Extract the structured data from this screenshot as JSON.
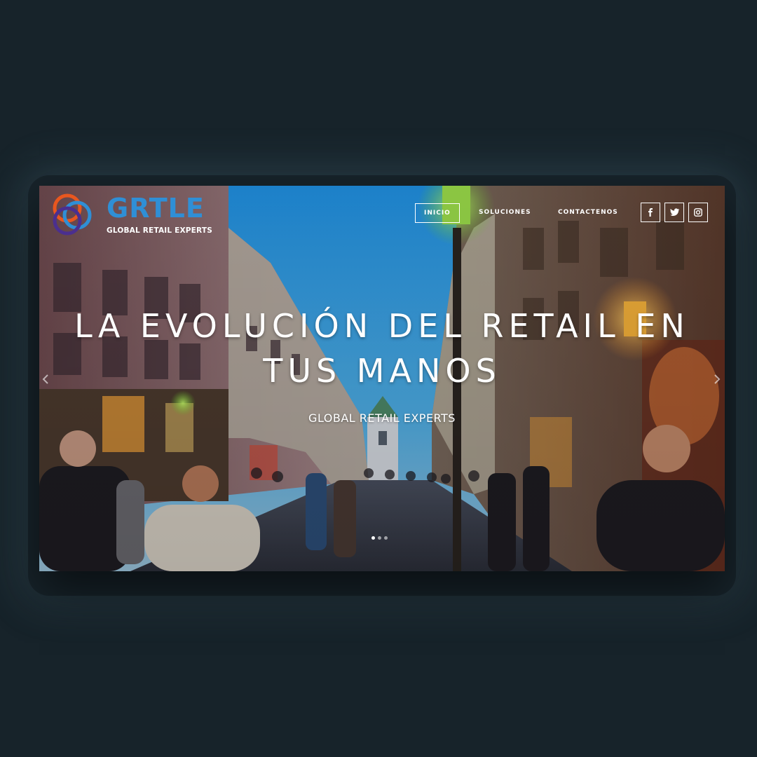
{
  "brand": {
    "name": "GRTLE",
    "tagline": "GLOBAL RETAIL EXPERTS",
    "colors": {
      "word": "#2f8fd6",
      "ring_orange": "#e8571f",
      "ring_blue": "#2f8fd6",
      "ring_purple": "#4b2f8f"
    }
  },
  "nav": {
    "items": [
      {
        "label": "INICIO",
        "active": true
      },
      {
        "label": "SOLUCIONES",
        "active": false
      },
      {
        "label": "CONTACTENOS",
        "active": false
      }
    ]
  },
  "social": {
    "items": [
      {
        "icon": "facebook-icon"
      },
      {
        "icon": "twitter-icon"
      },
      {
        "icon": "instagram-icon"
      }
    ]
  },
  "hero": {
    "headline_line1": "LA EVOLUCIÓN DEL RETAIL EN",
    "headline_line2": "TUS MANOS",
    "subheadline": "GLOBAL RETAIL EXPERTS",
    "slides_total": 3,
    "active_slide": 1
  },
  "colors": {
    "page_bg": "#17232a",
    "sky": "#2b9ae0",
    "accent_lamp": "#f2a62a"
  }
}
